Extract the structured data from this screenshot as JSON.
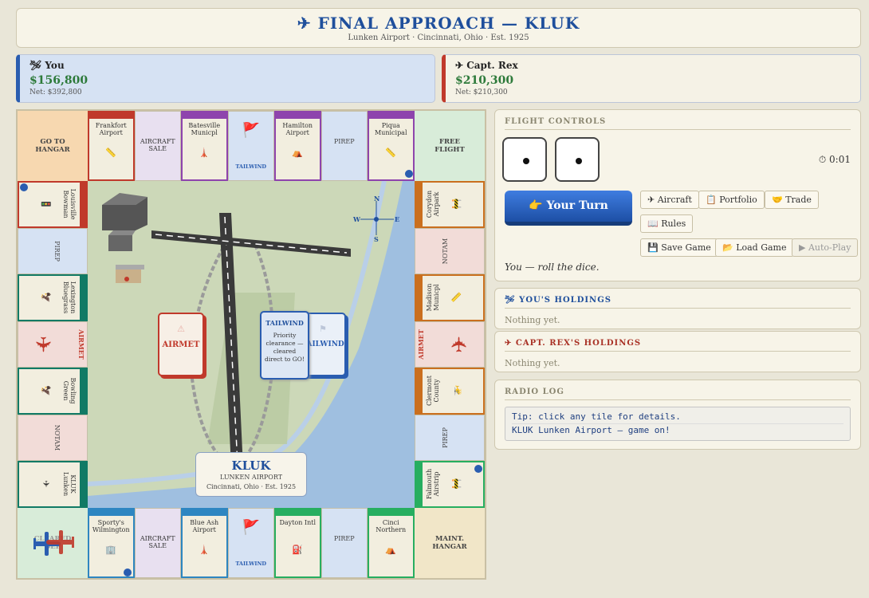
{
  "header": {
    "title": "✈ FINAL APPROACH — KLUK",
    "subtitle": "Lunken Airport · Cincinnati, Ohio · Est. 1925"
  },
  "players": [
    {
      "name": "🛩 You",
      "cash": "$156,800",
      "net": "Net: $392,800",
      "color": "#2a5db0"
    },
    {
      "name": "✈ Capt. Rex",
      "cash": "$210,300",
      "net": "Net: $210,300",
      "color": "#c0392b"
    }
  ],
  "board": {
    "corners": {
      "top_left": "GO TO\nHANGAR",
      "top_right": "FREE\nFLIGHT",
      "bottom_left": "CLEARED\nDEP",
      "bottom_right": "MAINT.\nHANGAR"
    },
    "top": [
      {
        "name": "Frankfort Airport",
        "color": "#c0392b",
        "glyph": "📏"
      },
      {
        "name": "AIRCRAFT SALE",
        "special": true
      },
      {
        "name": "Batesville Municpl",
        "color": "#8e44ad",
        "glyph": "🗼"
      },
      {
        "name": "TAILWIND",
        "special": true,
        "glyph": "🚩"
      },
      {
        "name": "Hamilton Airport",
        "color": "#8e44ad",
        "glyph": "⛺"
      },
      {
        "name": "PIREP",
        "special": true
      },
      {
        "name": "Piqua Municipal",
        "color": "#8e44ad",
        "glyph": "📏"
      }
    ],
    "bottom": [
      {
        "name": "Sporty's Wilmington",
        "color": "#2e86c1",
        "glyph": "🏢"
      },
      {
        "name": "AIRCRAFT SALE",
        "special": true
      },
      {
        "name": "Blue Ash Airport",
        "color": "#2e86c1",
        "glyph": "🗼"
      },
      {
        "name": "TAILWIND",
        "special": true,
        "glyph": "🚩"
      },
      {
        "name": "Dayton Intl",
        "color": "#27ae60",
        "glyph": "⛽"
      },
      {
        "name": "PIREP",
        "special": true
      },
      {
        "name": "Cinci Northern",
        "color": "#27ae60",
        "glyph": "⛺"
      }
    ],
    "left": [
      {
        "name": "Louisville Bowman",
        "color": "#c0392b",
        "glyph": "🚦"
      },
      {
        "name": "PIREP",
        "special": true
      },
      {
        "name": "Lexington Bluegrass",
        "color": "#117a65",
        "glyph": "🦅"
      },
      {
        "name": "AIRMET",
        "special": true
      },
      {
        "name": "Bowling Green",
        "color": "#117a65",
        "glyph": "🦅"
      },
      {
        "name": "NOTAM",
        "special": true
      },
      {
        "name": "KLUK Lunken",
        "color": "#117a65",
        "glyph": "✈"
      }
    ],
    "right": [
      {
        "name": "Corydon Airpark",
        "color": "#ca6f1e",
        "glyph": "🚧"
      },
      {
        "name": "NOTAM",
        "special": true
      },
      {
        "name": "Madison Municpl",
        "color": "#ca6f1e",
        "glyph": "📏"
      },
      {
        "name": "AIRMET",
        "special": true
      },
      {
        "name": "Clermont County",
        "color": "#ca6f1e",
        "glyph": "🚁"
      },
      {
        "name": "PIREP",
        "special": true
      },
      {
        "name": "Falmouth Airstrip",
        "color": "#27ae60",
        "glyph": "🚧"
      }
    ],
    "compass": {
      "n": "N",
      "s": "S",
      "e": "E",
      "w": "W"
    },
    "decks": {
      "airmet": "AIRMET",
      "tailwind": "TAILWIND",
      "tailwind_card_title": "TAILWIND",
      "tailwind_card_text": "Priority clearance — cleared direct to GO!"
    },
    "plate": {
      "code": "KLUK",
      "name": "LUNKEN AIRPORT",
      "detail": "Cincinnati, Ohio · Est. 1925"
    }
  },
  "controls": {
    "heading": "FLIGHT CONTROLS",
    "dice": [
      1,
      1
    ],
    "timer": "⏱ 0:01",
    "turn_button": "👉 Your Turn",
    "buttons": {
      "aircraft": "✈ Aircraft",
      "portfolio": "📋 Portfolio",
      "trade": "🤝 Trade",
      "rules": "📖 Rules",
      "save": "💾 Save Game",
      "load": "📂 Load Game",
      "autoplay": "▶ Auto-Play"
    },
    "status": "You — roll the dice."
  },
  "holdings": [
    {
      "heading": "🛩 YOU'S HOLDINGS",
      "color": "#1f4f9c",
      "empty": "Nothing yet."
    },
    {
      "heading": "✈ CAPT. REX'S HOLDINGS",
      "color": "#a93226",
      "empty": "Nothing yet."
    }
  ],
  "radio": {
    "heading": "RADIO LOG",
    "lines": [
      "Tip: click any tile for details.",
      "KLUK Lunken Airport — game on!"
    ]
  }
}
